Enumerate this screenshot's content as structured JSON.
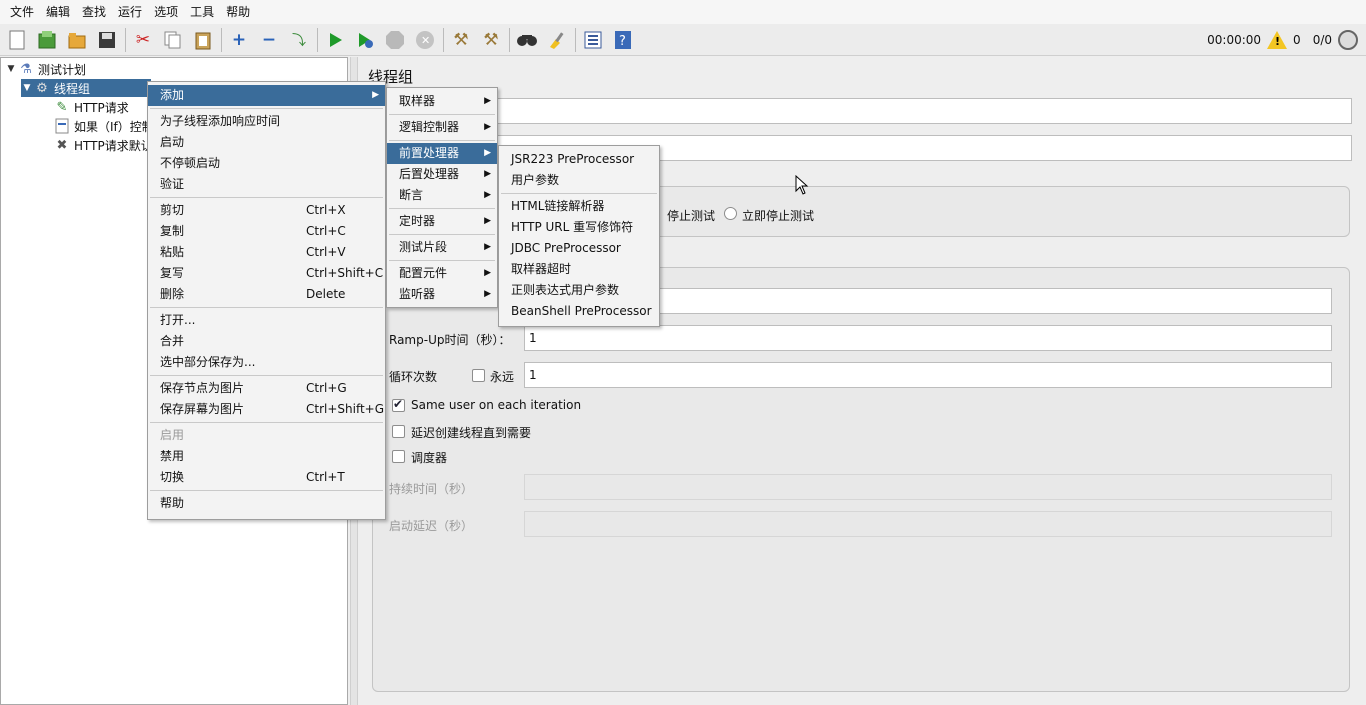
{
  "menubar": [
    "文件",
    "编辑",
    "查找",
    "运行",
    "选项",
    "工具",
    "帮助"
  ],
  "toolbar": {
    "icons": [
      "new-icon",
      "templates-icon",
      "open-icon",
      "save-icon",
      "cut-icon",
      "copy-icon",
      "paste-icon",
      "expand-icon",
      "collapse-icon",
      "toggle-icon",
      "start-icon",
      "start-no-pause-icon",
      "stop-icon",
      "shutdown-icon",
      "clear-icon",
      "clear-all-icon",
      "search-icon",
      "reset-search-icon",
      "function-helper-icon",
      "help-icon"
    ],
    "timer": "00:00:00",
    "warnings": "0",
    "threads": "0/0"
  },
  "tree": {
    "items": [
      {
        "label": "测试计划"
      },
      {
        "label": "线程组"
      },
      {
        "label": "HTTP请求"
      },
      {
        "label": "如果（If）控制"
      },
      {
        "label": "HTTP请求默认"
      }
    ]
  },
  "panel": {
    "title": "线程组",
    "on_error": {
      "stop_test": "停止测试",
      "stop_now": "立即停止测试"
    },
    "rampup_label": "Ramp-Up时间（秒）：",
    "rampup_value": "1",
    "loop_label": "循环次数",
    "forever_label": "永远",
    "loop_value": "1",
    "same_user_label": "Same user on each iteration",
    "delay_label": "延迟创建线程直到需要",
    "scheduler_label": "调度器",
    "duration_label": "持续时间（秒）",
    "startup_delay_label": "启动延迟（秒）"
  },
  "context_menu": {
    "add": "添加",
    "add_think_time": "为子线程添加响应时间",
    "start": "启动",
    "start_no_pause": "不停顿启动",
    "validate": "验证",
    "cut": "剪切",
    "cut_sc": "Ctrl+X",
    "copy": "复制",
    "copy_sc": "Ctrl+C",
    "paste": "粘贴",
    "paste_sc": "Ctrl+V",
    "duplicate": "复写",
    "duplicate_sc": "Ctrl+Shift+C",
    "delete": "删除",
    "delete_sc": "Delete",
    "open": "打开...",
    "merge": "合并",
    "save_as": "选中部分保存为...",
    "save_node_img": "保存节点为图片",
    "save_node_img_sc": "Ctrl+G",
    "save_screen_img": "保存屏幕为图片",
    "save_screen_img_sc": "Ctrl+Shift+G",
    "enable": "启用",
    "disable": "禁用",
    "toggle": "切换",
    "toggle_sc": "Ctrl+T",
    "help": "帮助"
  },
  "add_submenu": {
    "sampler": "取样器",
    "logic_controller": "逻辑控制器",
    "pre_processor": "前置处理器",
    "post_processor": "后置处理器",
    "assertion": "断言",
    "timer": "定时器",
    "test_fragment": "测试片段",
    "config_element": "配置元件",
    "listener": "监听器"
  },
  "pre_submenu": {
    "jsr223": "JSR223 PreProcessor",
    "user_params": "用户参数",
    "html_link": "HTML链接解析器",
    "url_rewrite": "HTTP URL 重写修饰符",
    "jdbc": "JDBC PreProcessor",
    "sampler_timeout": "取样器超时",
    "regex_user_params": "正则表达式用户参数",
    "beanshell": "BeanShell PreProcessor"
  }
}
